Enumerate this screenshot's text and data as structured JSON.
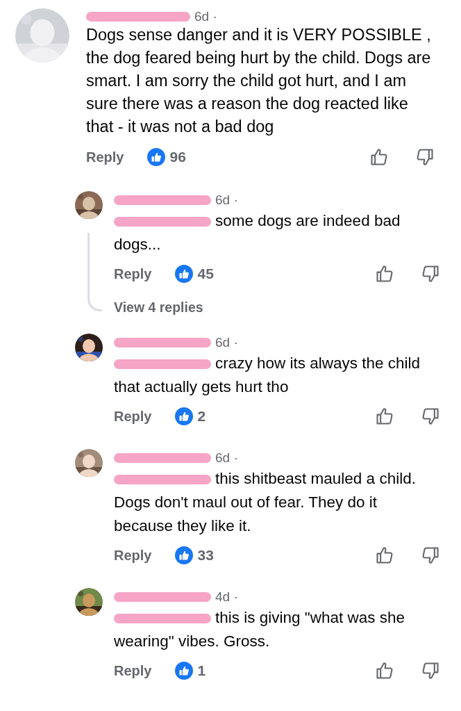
{
  "comments": [
    {
      "kind": "top",
      "time": "6d ·",
      "mention": false,
      "text": "Dogs sense danger and it is VERY POSSIBLE , the dog feared being hurt by the child. Dogs are smart.   I am sorry the child got hurt, and I am sure there was a reason the dog reacted like that - it was not a bad dog",
      "reply": "Reply",
      "likes": "96"
    },
    {
      "kind": "reply",
      "time": "6d ·",
      "mention": true,
      "text": "some dogs are indeed bad dogs...",
      "reply": "Reply",
      "likes": "45",
      "view_replies": "View 4 replies"
    },
    {
      "kind": "reply",
      "time": "6d ·",
      "mention": true,
      "text": "crazy how its always the child that actually gets hurt tho",
      "reply": "Reply",
      "likes": "2"
    },
    {
      "kind": "reply",
      "time": "6d ·",
      "mention": true,
      "text": "this shitbeast mauled a child. Dogs don't maul out of fear. They do it because they like it.",
      "reply": "Reply",
      "likes": "33"
    },
    {
      "kind": "reply",
      "time": "4d ·",
      "mention": true,
      "text": "this is giving \"what was she wearing\" vibes. Gross.",
      "reply": "Reply",
      "likes": "1"
    }
  ]
}
